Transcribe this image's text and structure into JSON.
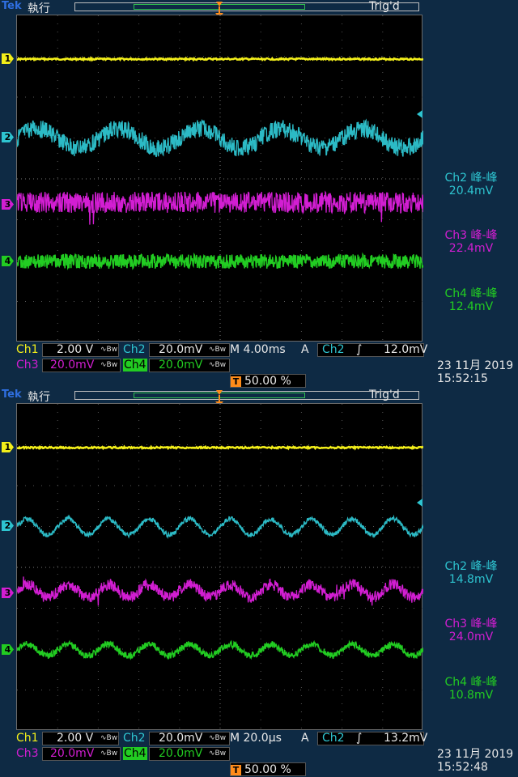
{
  "scopes": [
    {
      "brand": "Tek",
      "status": "執行",
      "trig_state": "Trig'd",
      "trigger_marker": "T",
      "channels": [
        {
          "id": "1",
          "color": "#f2ee1a"
        },
        {
          "id": "2",
          "color": "#2ec4d0"
        },
        {
          "id": "3",
          "color": "#d21ed2"
        },
        {
          "id": "4",
          "color": "#22cc22"
        }
      ],
      "measurements": [
        {
          "label": "Ch2 峰-峰",
          "value": "20.4mV",
          "color": "#2ec4d0"
        },
        {
          "label": "Ch3 峰-峰",
          "value": "22.4mV",
          "color": "#d21ed2"
        },
        {
          "label": "Ch4 峰-峰",
          "value": "12.4mV",
          "color": "#22cc22"
        }
      ],
      "readout": {
        "ch1": "Ch1",
        "ch1_scale": "2.00 V",
        "ch2": "Ch2",
        "ch2_scale": "20.0mV",
        "ch3": "Ch3",
        "ch3_scale": "20.0mV",
        "ch4": "Ch4",
        "ch4_scale": "20.0mV",
        "bw": "∿Bw",
        "timebase": "M 4.00ms",
        "acq_mode": "A",
        "trig_source": "Ch2",
        "trig_slope": "∫",
        "trig_level": "12.0mV",
        "trig_position": "50.00 %"
      },
      "date": "23 11月 2019",
      "time": "15:52:15",
      "waves": {
        "ch2_cycles": 5,
        "ch3_cycles": 0,
        "ch4_cycles": 0
      }
    },
    {
      "brand": "Tek",
      "status": "執行",
      "trig_state": "Trig'd",
      "trigger_marker": "T",
      "channels": [
        {
          "id": "1",
          "color": "#f2ee1a"
        },
        {
          "id": "2",
          "color": "#2ec4d0"
        },
        {
          "id": "3",
          "color": "#d21ed2"
        },
        {
          "id": "4",
          "color": "#22cc22"
        }
      ],
      "measurements": [
        {
          "label": "Ch2 峰-峰",
          "value": "14.8mV",
          "color": "#2ec4d0"
        },
        {
          "label": "Ch3 峰-峰",
          "value": "24.0mV",
          "color": "#d21ed2"
        },
        {
          "label": "Ch4 峰-峰",
          "value": "10.8mV",
          "color": "#22cc22"
        }
      ],
      "readout": {
        "ch1": "Ch1",
        "ch1_scale": "2.00 V",
        "ch2": "Ch2",
        "ch2_scale": "20.0mV",
        "ch3": "Ch3",
        "ch3_scale": "20.0mV",
        "ch4": "Ch4",
        "ch4_scale": "20.0mV",
        "bw": "∿Bw",
        "timebase": "M 20.0µs",
        "acq_mode": "A",
        "trig_source": "Ch2",
        "trig_slope": "∫",
        "trig_level": "13.2mV",
        "trig_position": "50.00 %"
      },
      "date": "23 11月 2019",
      "time": "15:52:48",
      "waves": {
        "ch2_cycles": 10,
        "ch3_cycles": 10,
        "ch4_cycles": 10
      }
    }
  ]
}
